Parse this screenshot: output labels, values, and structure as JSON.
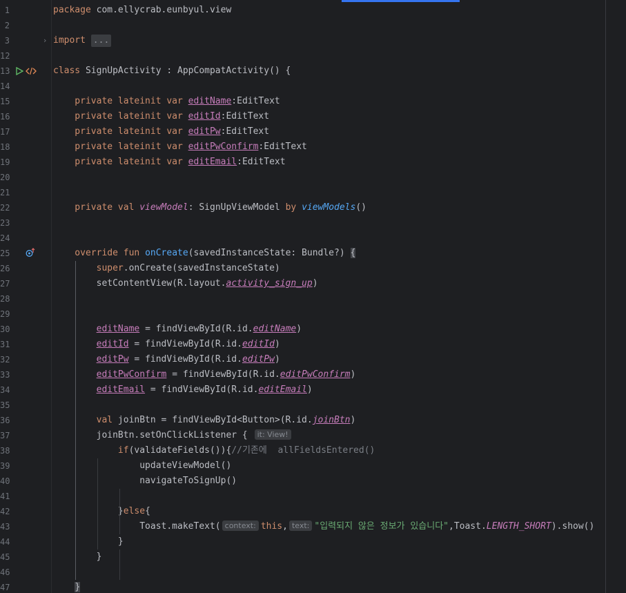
{
  "editor": {
    "lines": [
      {
        "num": "1",
        "tokens": [
          {
            "t": "package",
            "c": "kw"
          },
          {
            "t": " com.ellycrab.eunbyul.view",
            "c": "pl"
          }
        ]
      },
      {
        "num": "2",
        "tokens": []
      },
      {
        "num": "3",
        "fold": true,
        "tokens": [
          {
            "t": "import",
            "c": "kw"
          },
          {
            "t": " ",
            "c": "pl"
          },
          {
            "t": "...",
            "c": "fold-box"
          }
        ]
      },
      {
        "num": "12",
        "tokens": []
      },
      {
        "num": "13",
        "icons": [
          "run-icon",
          "code-icon"
        ],
        "tokens": [
          {
            "t": "class",
            "c": "kw"
          },
          {
            "t": " SignUpActivity : AppCompatActivity() {",
            "c": "pl"
          }
        ]
      },
      {
        "num": "14",
        "tokens": []
      },
      {
        "num": "15",
        "tokens": [
          {
            "t": "    private lateinit var ",
            "c": "kw"
          },
          {
            "t": "editName",
            "c": "fld"
          },
          {
            "t": ":EditText",
            "c": "pl"
          }
        ]
      },
      {
        "num": "16",
        "tokens": [
          {
            "t": "    private lateinit var ",
            "c": "kw"
          },
          {
            "t": "editId",
            "c": "fld"
          },
          {
            "t": ":EditText",
            "c": "pl"
          }
        ]
      },
      {
        "num": "17",
        "tokens": [
          {
            "t": "    private lateinit var ",
            "c": "kw"
          },
          {
            "t": "editPw",
            "c": "fld"
          },
          {
            "t": ":EditText",
            "c": "pl"
          }
        ]
      },
      {
        "num": "18",
        "tokens": [
          {
            "t": "    private lateinit var ",
            "c": "kw"
          },
          {
            "t": "editPwConfirm",
            "c": "fld"
          },
          {
            "t": ":EditText",
            "c": "pl"
          }
        ]
      },
      {
        "num": "19",
        "tokens": [
          {
            "t": "    private lateinit var ",
            "c": "kw"
          },
          {
            "t": "editEmail",
            "c": "fld"
          },
          {
            "t": ":EditText",
            "c": "pl"
          }
        ]
      },
      {
        "num": "20",
        "tokens": []
      },
      {
        "num": "21",
        "tokens": []
      },
      {
        "num": "22",
        "tokens": [
          {
            "t": "    private val ",
            "c": "kw"
          },
          {
            "t": "viewModel",
            "c": "cst"
          },
          {
            "t": ": SignUpViewModel ",
            "c": "pl"
          },
          {
            "t": "by ",
            "c": "kw"
          },
          {
            "t": "viewModels",
            "c": "ext"
          },
          {
            "t": "()",
            "c": "pl"
          }
        ]
      },
      {
        "num": "23",
        "tokens": []
      },
      {
        "num": "24",
        "tokens": []
      },
      {
        "num": "25",
        "icons": [
          "override-icon"
        ],
        "tokens": [
          {
            "t": "    override fun ",
            "c": "kw"
          },
          {
            "t": "onCreate",
            "c": "fn"
          },
          {
            "t": "(savedInstanceState: Bundle?) ",
            "c": "pl"
          },
          {
            "t": "{",
            "c": "brace-hl"
          }
        ]
      },
      {
        "num": "26",
        "tokens": [
          {
            "t": "        super",
            "c": "kw"
          },
          {
            "t": ".onCreate(savedInstanceState)",
            "c": "pl"
          }
        ]
      },
      {
        "num": "27",
        "tokens": [
          {
            "t": "        setContentView(R.layout.",
            "c": "pl"
          },
          {
            "t": "activity_sign_up",
            "c": "fldi"
          },
          {
            "t": ")",
            "c": "pl"
          }
        ]
      },
      {
        "num": "28",
        "tokens": []
      },
      {
        "num": "29",
        "tokens": []
      },
      {
        "num": "30",
        "tokens": [
          {
            "t": "        ",
            "c": "pl"
          },
          {
            "t": "editName",
            "c": "fld"
          },
          {
            "t": " = findViewById(R.id.",
            "c": "pl"
          },
          {
            "t": "editName",
            "c": "fldi"
          },
          {
            "t": ")",
            "c": "pl"
          }
        ]
      },
      {
        "num": "31",
        "tokens": [
          {
            "t": "        ",
            "c": "pl"
          },
          {
            "t": "editId",
            "c": "fld"
          },
          {
            "t": " = findViewById(R.id.",
            "c": "pl"
          },
          {
            "t": "editId",
            "c": "fldi"
          },
          {
            "t": ")",
            "c": "pl"
          }
        ]
      },
      {
        "num": "32",
        "tokens": [
          {
            "t": "        ",
            "c": "pl"
          },
          {
            "t": "editPw",
            "c": "fld"
          },
          {
            "t": " = findViewById(R.id.",
            "c": "pl"
          },
          {
            "t": "editPw",
            "c": "fldi"
          },
          {
            "t": ")",
            "c": "pl"
          }
        ]
      },
      {
        "num": "33",
        "tokens": [
          {
            "t": "        ",
            "c": "pl"
          },
          {
            "t": "editPwConfirm",
            "c": "fld"
          },
          {
            "t": " = findViewById(R.id.",
            "c": "pl"
          },
          {
            "t": "editPwConfirm",
            "c": "fldi"
          },
          {
            "t": ")",
            "c": "pl"
          }
        ]
      },
      {
        "num": "34",
        "tokens": [
          {
            "t": "        ",
            "c": "pl"
          },
          {
            "t": "editEmail",
            "c": "fld"
          },
          {
            "t": " = findViewById(R.id.",
            "c": "pl"
          },
          {
            "t": "editEmail",
            "c": "fldi"
          },
          {
            "t": ")",
            "c": "pl"
          }
        ]
      },
      {
        "num": "35",
        "tokens": []
      },
      {
        "num": "36",
        "tokens": [
          {
            "t": "        val ",
            "c": "kw"
          },
          {
            "t": "joinBtn = findViewById<Button>(R.id.",
            "c": "pl"
          },
          {
            "t": "joinBtn",
            "c": "fldi"
          },
          {
            "t": ")",
            "c": "pl"
          }
        ]
      },
      {
        "num": "37",
        "tokens": [
          {
            "t": "        joinBtn.setOnClickListener { ",
            "c": "pl"
          },
          {
            "t": "it: View!",
            "c": "hint"
          }
        ]
      },
      {
        "num": "38",
        "tokens": [
          {
            "t": "            if",
            "c": "kw"
          },
          {
            "t": "(validateFields()){",
            "c": "pl"
          },
          {
            "t": "//기존에  allFieldsEntered()",
            "c": "cmt"
          }
        ]
      },
      {
        "num": "39",
        "tokens": [
          {
            "t": "                updateViewModel()",
            "c": "pl"
          }
        ]
      },
      {
        "num": "40",
        "tokens": [
          {
            "t": "                navigateToSignUp()",
            "c": "pl"
          }
        ]
      },
      {
        "num": "41",
        "tokens": []
      },
      {
        "num": "42",
        "tokens": [
          {
            "t": "            }",
            "c": "pl"
          },
          {
            "t": "else",
            "c": "kw"
          },
          {
            "t": "{",
            "c": "pl"
          }
        ]
      },
      {
        "num": "43",
        "tokens": [
          {
            "t": "                Toast.makeText(",
            "c": "pl"
          },
          {
            "t": "context:",
            "c": "hint"
          },
          {
            "t": "this",
            "c": "kw"
          },
          {
            "t": ",",
            "c": "pl"
          },
          {
            "t": "text:",
            "c": "hint"
          },
          {
            "t": "\"입력되지 않은 정보가 있습니다\"",
            "c": "str"
          },
          {
            "t": ",Toast.",
            "c": "pl"
          },
          {
            "t": "LENGTH_SHORT",
            "c": "cst"
          },
          {
            "t": ").show()",
            "c": "pl"
          }
        ]
      },
      {
        "num": "44",
        "tokens": [
          {
            "t": "            }",
            "c": "pl"
          }
        ]
      },
      {
        "num": "45",
        "tokens": [
          {
            "t": "        }",
            "c": "pl"
          }
        ]
      },
      {
        "num": "46",
        "tokens": []
      },
      {
        "num": "47",
        "tokens": [
          {
            "t": "    ",
            "c": "pl"
          },
          {
            "t": "}",
            "c": "brace-hl"
          }
        ]
      }
    ]
  },
  "colors": {
    "background": "#1e1f22",
    "keyword": "#cf8e6d",
    "field": "#c77dbb",
    "function": "#56a8f5",
    "string": "#6aab73",
    "comment": "#7a7e85",
    "accent": "#3574f0"
  }
}
